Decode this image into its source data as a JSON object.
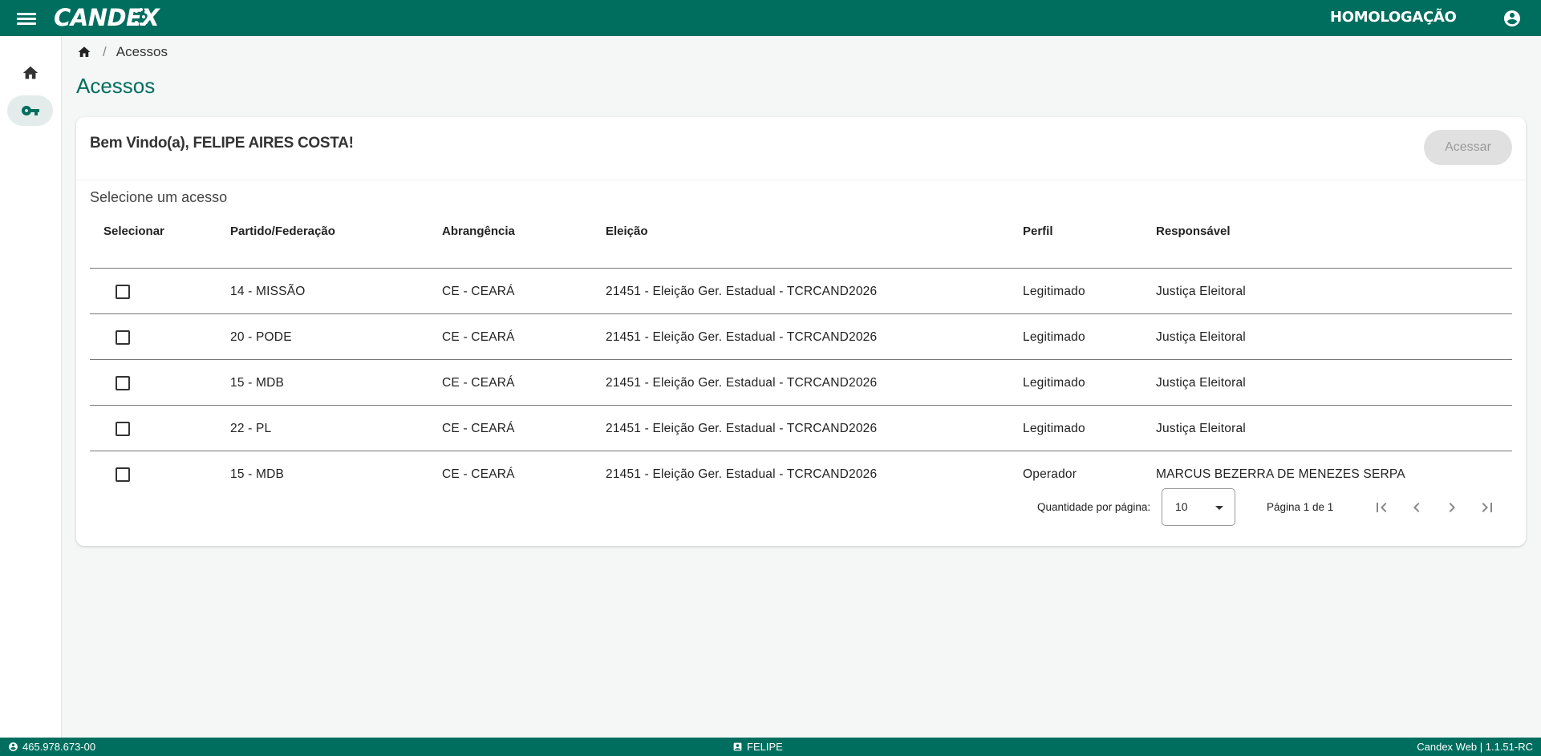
{
  "header": {
    "logo": "CANDEX",
    "environment": "HOMOLOGAÇÃO"
  },
  "breadcrumb": {
    "current": "Acessos"
  },
  "page": {
    "title": "Acessos"
  },
  "card": {
    "welcome": "Bem Vindo(a), FELIPE AIRES COSTA!",
    "access_button": "Acessar",
    "select_caption": "Selecione um acesso"
  },
  "table": {
    "headers": {
      "select": "Selecionar",
      "party": "Partido/Federação",
      "scope": "Abrangência",
      "election": "Eleição",
      "profile": "Perfil",
      "responsible": "Responsável"
    },
    "rows": [
      {
        "party": "14 - MISSÃO",
        "scope": "CE - CEARÁ",
        "election": "21451 - Eleição Ger. Estadual - TCRCAND2026",
        "profile": "Legitimado",
        "responsible": "Justiça Eleitoral"
      },
      {
        "party": "20 - PODE",
        "scope": "CE - CEARÁ",
        "election": "21451 - Eleição Ger. Estadual - TCRCAND2026",
        "profile": "Legitimado",
        "responsible": "Justiça Eleitoral"
      },
      {
        "party": "15 - MDB",
        "scope": "CE - CEARÁ",
        "election": "21451 - Eleição Ger. Estadual - TCRCAND2026",
        "profile": "Legitimado",
        "responsible": "Justiça Eleitoral"
      },
      {
        "party": "22 - PL",
        "scope": "CE - CEARÁ",
        "election": "21451 - Eleição Ger. Estadual - TCRCAND2026",
        "profile": "Legitimado",
        "responsible": "Justiça Eleitoral"
      },
      {
        "party": "15 - MDB",
        "scope": "CE - CEARÁ",
        "election": "21451 - Eleição Ger. Estadual - TCRCAND2026",
        "profile": "Operador",
        "responsible": "MARCUS BEZERRA DE MENEZES SERPA"
      }
    ]
  },
  "pagination": {
    "page_size_label": "Quantidade por página:",
    "page_size": "10",
    "page_info": "Página 1 de 1"
  },
  "footer": {
    "cpf": "465.978.673-00",
    "user": "FELIPE",
    "version": "Candex Web | 1.1.51-RC"
  },
  "colors": {
    "primary": "#006e5f",
    "background": "#f4f7f6",
    "disabled_button": "#e0e0e0"
  },
  "icons": [
    "menu-icon",
    "account-circle-icon",
    "home-icon",
    "key-icon",
    "first-page-icon",
    "chevron-left-icon",
    "chevron-right-icon",
    "last-page-icon",
    "account-circle-icon",
    "badge-icon"
  ]
}
